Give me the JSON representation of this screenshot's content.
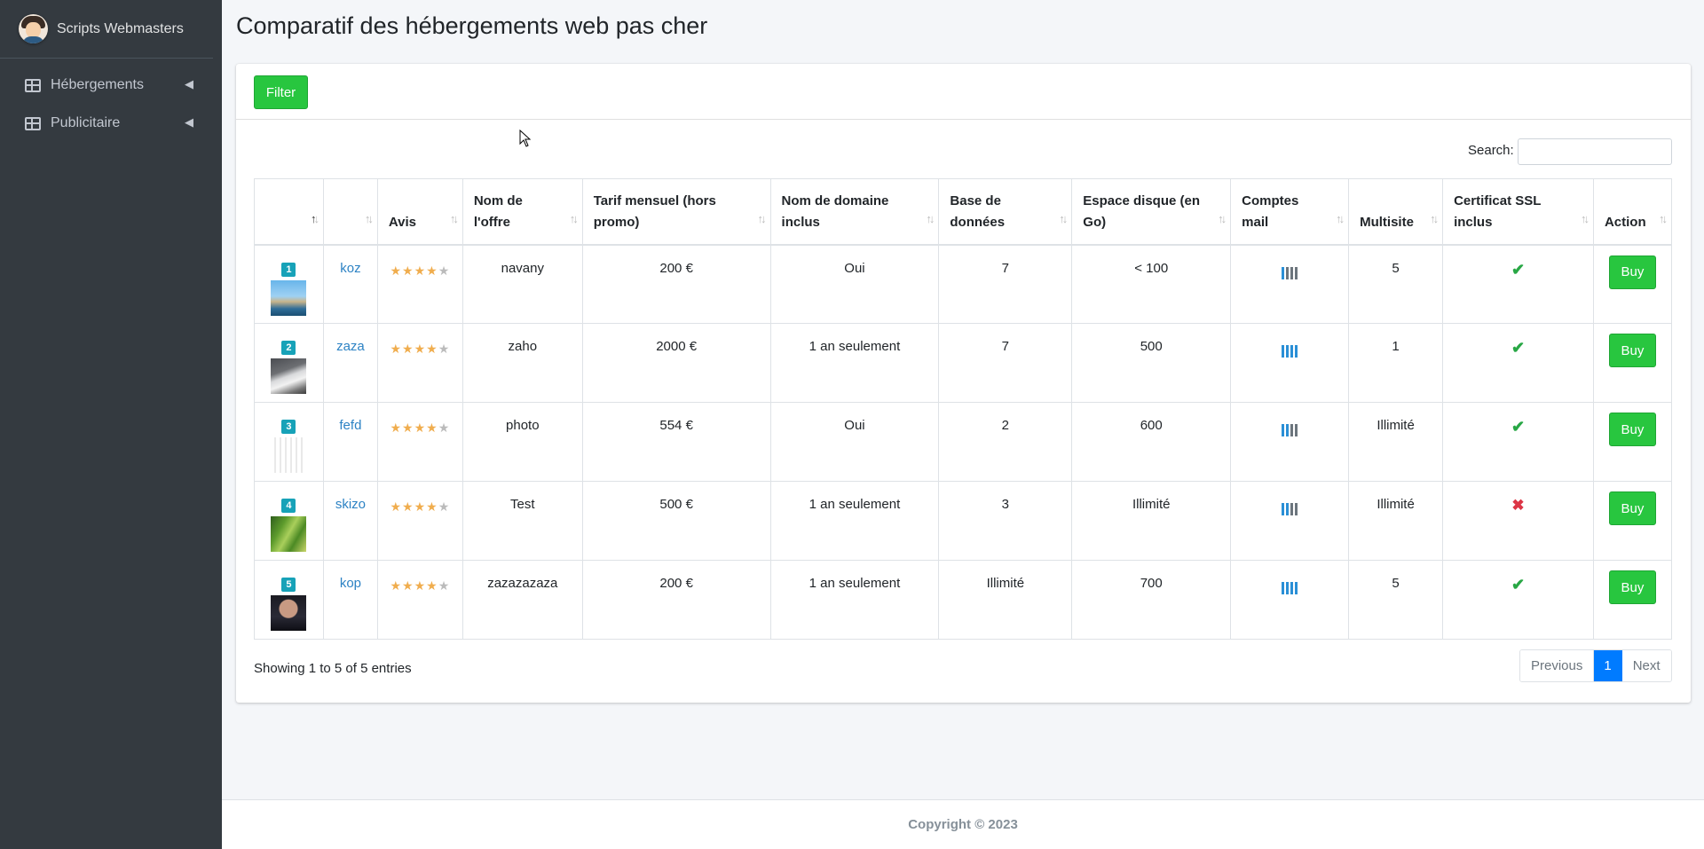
{
  "sidebar": {
    "brand": "Scripts Webmasters",
    "items": [
      {
        "label": "Hébergements"
      },
      {
        "label": "Publicitaire"
      }
    ]
  },
  "page": {
    "title": "Comparatif des hébergements web pas cher"
  },
  "toolbar": {
    "filter_label": "Filter"
  },
  "search": {
    "label": "Search:",
    "value": ""
  },
  "table": {
    "headers": [
      "",
      "",
      "Avis",
      "Nom de l'offre",
      "Tarif mensuel (hors promo)",
      "Nom de domaine inclus",
      "Base de données",
      "Espace disque (en Go)",
      "Comptes mail",
      "Multisite",
      "Certificat SSL inclus",
      "Action"
    ],
    "rows": [
      {
        "rank": "1",
        "name": "koz",
        "rating": 4,
        "offer": "navany",
        "price": "200 €",
        "domain": "Oui",
        "db": "7",
        "disk": "< 100",
        "mail_level": 1,
        "multisite": "5",
        "ssl": true,
        "action": "Buy",
        "thumb": "beach-image"
      },
      {
        "rank": "2",
        "name": "zaza",
        "rating": 4,
        "offer": "zaho",
        "price": "2000 €",
        "domain": "1 an seulement",
        "db": "7",
        "disk": "500",
        "mail_level": 4,
        "multisite": "1",
        "ssl": true,
        "action": "Buy",
        "thumb": "car-image"
      },
      {
        "rank": "3",
        "name": "fefd",
        "rating": 4,
        "offer": "photo",
        "price": "554 €",
        "domain": "Oui",
        "db": "2",
        "disk": "600",
        "mail_level": 2,
        "multisite": "Illimité",
        "ssl": true,
        "action": "Buy",
        "thumb": "photo-grid-image"
      },
      {
        "rank": "4",
        "name": "skizo",
        "rating": 4,
        "offer": "Test",
        "price": "500 €",
        "domain": "1 an seulement",
        "db": "3",
        "disk": "Illimité",
        "mail_level": 2,
        "multisite": "Illimité",
        "ssl": false,
        "action": "Buy",
        "thumb": "plant-image"
      },
      {
        "rank": "5",
        "name": "kop",
        "rating": 4,
        "offer": "zazazazaza",
        "price": "200 €",
        "domain": "1 an seulement",
        "db": "Illimité",
        "disk": "700",
        "mail_level": 4,
        "multisite": "5",
        "ssl": true,
        "action": "Buy",
        "thumb": "portrait-image"
      }
    ]
  },
  "footer_info": {
    "text": "Showing 1 to 5 of 5 entries"
  },
  "pagination": {
    "previous": "Previous",
    "current": "1",
    "next": "Next"
  },
  "footer": {
    "copyright": "Copyright © 2023"
  },
  "colors": {
    "sidebar_bg": "#343a40",
    "button_green": "#28c63f",
    "link_blue": "#2c82c4",
    "star": "#f0ad4e",
    "page_active": "#007bff"
  }
}
